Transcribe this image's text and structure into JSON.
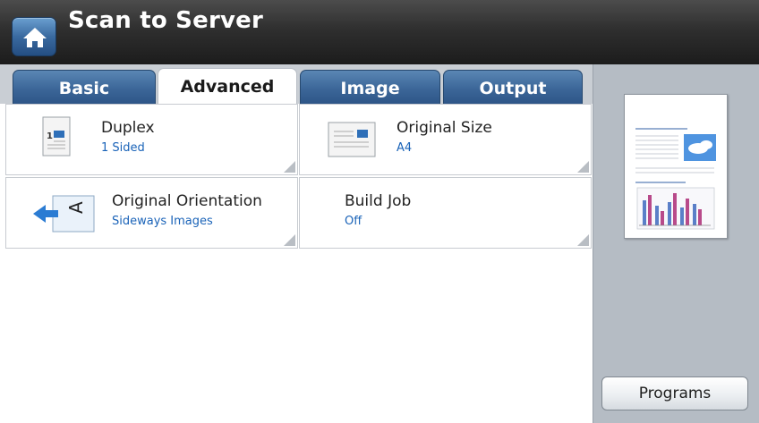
{
  "header": {
    "title": "Scan to Server",
    "home_icon": "home-icon"
  },
  "tabs": [
    {
      "label": "Basic",
      "active": false
    },
    {
      "label": "Advanced",
      "active": true
    },
    {
      "label": "Image",
      "active": false
    },
    {
      "label": "Output",
      "active": false
    }
  ],
  "options": {
    "duplex": {
      "label": "Duplex",
      "value": "1 Sided",
      "icon": "duplex-page-icon"
    },
    "original_size": {
      "label": "Original Size",
      "value": "A4",
      "icon": "original-size-icon"
    },
    "original_orientation": {
      "label": "Original Orientation",
      "value": "Sideways Images",
      "icon": "orientation-icon"
    },
    "build_job": {
      "label": "Build Job",
      "value": "Off"
    }
  },
  "side_panel": {
    "programs_label": "Programs",
    "preview_icon": "document-preview-icon"
  },
  "colors": {
    "accent_blue": "#1a63b8",
    "tab_blue": "#3b6698",
    "panel_gray": "#b5bcc4"
  }
}
